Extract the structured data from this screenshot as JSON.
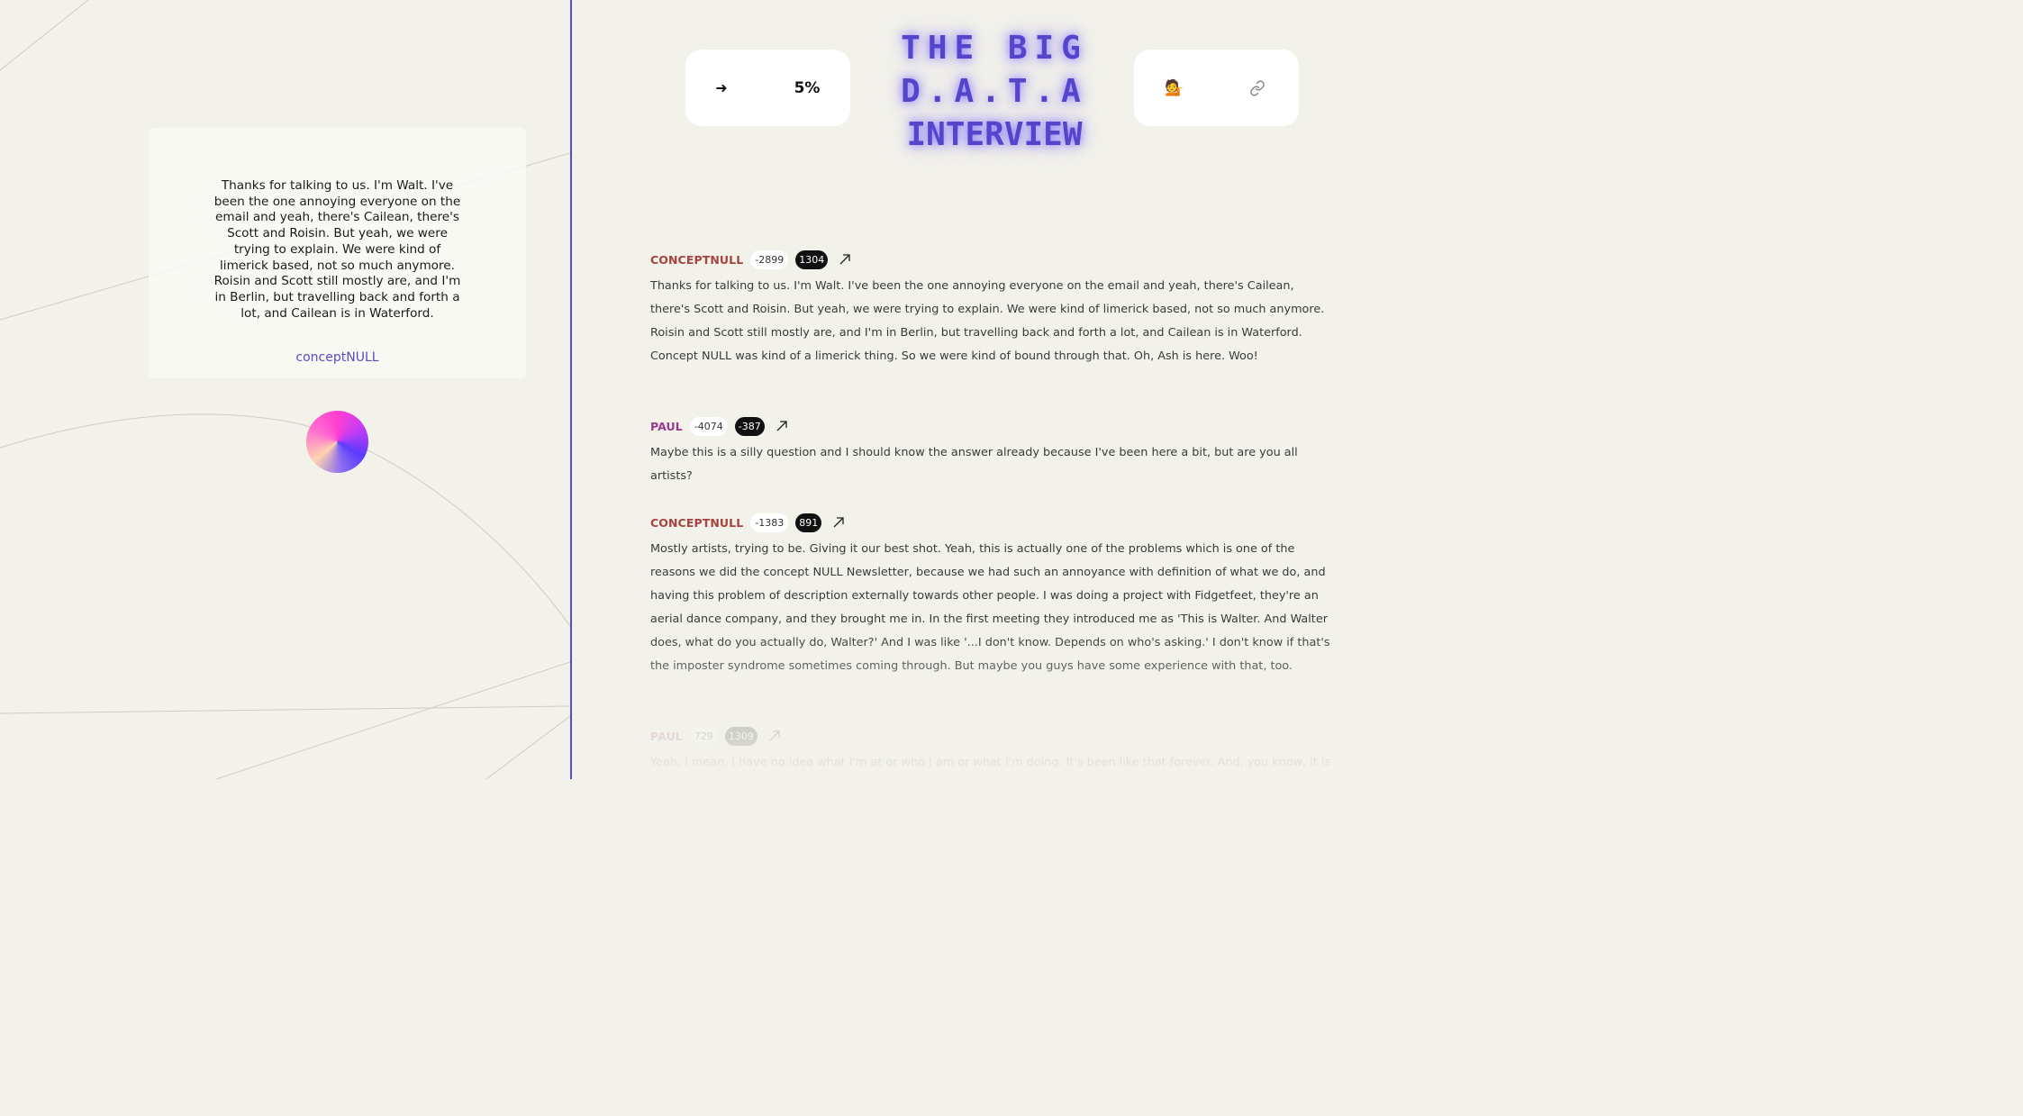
{
  "quote": {
    "text": "Thanks for talking to us. I'm Walt. I've been the one annoying everyone on the email and yeah, there's Cailean, there's Scott and Roisin. But yeah, we were trying to explain. We were kind of limerick based, not so much anymore. Roisin and Scott still mostly are, and I'm in Berlin, but travelling back and forth a lot, and Cailean is in Waterford.",
    "author": "conceptNULL"
  },
  "header": {
    "arrow": "➜",
    "progress": "5%",
    "progress_value": 0.05,
    "title_lines": [
      "THE BIG",
      "D.A.T.A",
      "INTERVIEW"
    ],
    "person_icon": "💁",
    "link_icon": "link-icon"
  },
  "transcript": [
    {
      "speaker": "CONCEPTNULL",
      "badge_light": "-2899",
      "badge_dark": "1304",
      "text": "Thanks for talking to us. I'm Walt. I've been the one annoying everyone on the email and yeah, there's Cailean, there's Scott and Roisin. But yeah, we were trying to explain. We were kind of limerick based, not so much anymore. Roisin and Scott still mostly are, and I'm in Berlin, but travelling back and forth a lot, and Cailean is in Waterford. Concept NULL was kind of a limerick thing. So we were kind of bound through that. Oh, Ash is here. Woo!"
    },
    {
      "speaker": "PAUL",
      "badge_light": "-4074",
      "badge_dark": "-387",
      "text": "Maybe this is a silly question and I should know the answer already because I've been here a bit, but are you all artists?"
    },
    {
      "speaker": "CONCEPTNULL",
      "badge_light": "-1383",
      "badge_dark": "891",
      "text": "Mostly artists, trying to be. Giving it our best shot. Yeah, this is actually one of the problems which is one of the reasons we did the concept NULL Newsletter, because we had such an annoyance with definition of what we do, and having this problem of description externally towards other people. I was doing a project with Fidgetfeet, they're an aerial dance company, and they brought me in. In the first meeting they introduced me as 'This is Walter. And Walter does, what do you actually do, Walter?' And I was like '...I don't know. Depends on who's asking.' I don't know if that's the imposter syndrome sometimes coming through. But maybe you guys have some experience with that, too."
    },
    {
      "speaker": "PAUL",
      "badge_light": "729",
      "badge_dark": "1309",
      "text": "Yeah, I mean, I have no idea what I'm at or who I am or what I'm doing. It's been like that forever. And, you know, it is what it"
    }
  ],
  "colors": {
    "accent": "#5b48d6",
    "conceptnull": "#a8423e",
    "paul": "#9a3a8e",
    "background": "#f2f1ea"
  }
}
